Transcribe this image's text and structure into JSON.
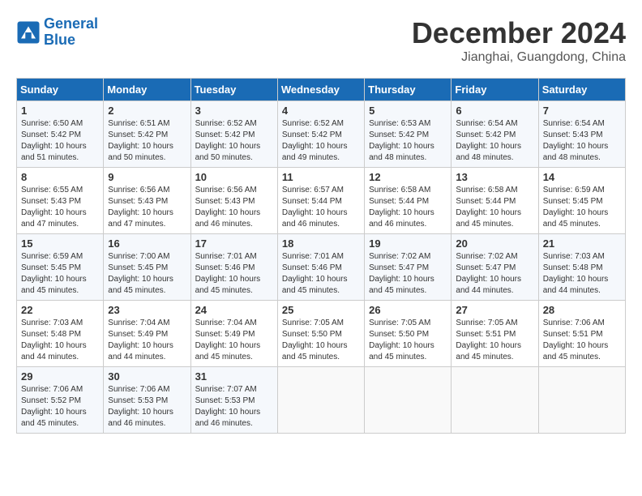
{
  "logo": {
    "line1": "General",
    "line2": "Blue"
  },
  "title": "December 2024",
  "location": "Jianghai, Guangdong, China",
  "days_of_week": [
    "Sunday",
    "Monday",
    "Tuesday",
    "Wednesday",
    "Thursday",
    "Friday",
    "Saturday"
  ],
  "weeks": [
    [
      {
        "day": "1",
        "sunrise": "6:50 AM",
        "sunset": "5:42 PM",
        "daylight": "10 hours and 51 minutes."
      },
      {
        "day": "2",
        "sunrise": "6:51 AM",
        "sunset": "5:42 PM",
        "daylight": "10 hours and 50 minutes."
      },
      {
        "day": "3",
        "sunrise": "6:52 AM",
        "sunset": "5:42 PM",
        "daylight": "10 hours and 50 minutes."
      },
      {
        "day": "4",
        "sunrise": "6:52 AM",
        "sunset": "5:42 PM",
        "daylight": "10 hours and 49 minutes."
      },
      {
        "day": "5",
        "sunrise": "6:53 AM",
        "sunset": "5:42 PM",
        "daylight": "10 hours and 48 minutes."
      },
      {
        "day": "6",
        "sunrise": "6:54 AM",
        "sunset": "5:42 PM",
        "daylight": "10 hours and 48 minutes."
      },
      {
        "day": "7",
        "sunrise": "6:54 AM",
        "sunset": "5:43 PM",
        "daylight": "10 hours and 48 minutes."
      }
    ],
    [
      {
        "day": "8",
        "sunrise": "6:55 AM",
        "sunset": "5:43 PM",
        "daylight": "10 hours and 47 minutes."
      },
      {
        "day": "9",
        "sunrise": "6:56 AM",
        "sunset": "5:43 PM",
        "daylight": "10 hours and 47 minutes."
      },
      {
        "day": "10",
        "sunrise": "6:56 AM",
        "sunset": "5:43 PM",
        "daylight": "10 hours and 46 minutes."
      },
      {
        "day": "11",
        "sunrise": "6:57 AM",
        "sunset": "5:44 PM",
        "daylight": "10 hours and 46 minutes."
      },
      {
        "day": "12",
        "sunrise": "6:58 AM",
        "sunset": "5:44 PM",
        "daylight": "10 hours and 46 minutes."
      },
      {
        "day": "13",
        "sunrise": "6:58 AM",
        "sunset": "5:44 PM",
        "daylight": "10 hours and 45 minutes."
      },
      {
        "day": "14",
        "sunrise": "6:59 AM",
        "sunset": "5:45 PM",
        "daylight": "10 hours and 45 minutes."
      }
    ],
    [
      {
        "day": "15",
        "sunrise": "6:59 AM",
        "sunset": "5:45 PM",
        "daylight": "10 hours and 45 minutes."
      },
      {
        "day": "16",
        "sunrise": "7:00 AM",
        "sunset": "5:45 PM",
        "daylight": "10 hours and 45 minutes."
      },
      {
        "day": "17",
        "sunrise": "7:01 AM",
        "sunset": "5:46 PM",
        "daylight": "10 hours and 45 minutes."
      },
      {
        "day": "18",
        "sunrise": "7:01 AM",
        "sunset": "5:46 PM",
        "daylight": "10 hours and 45 minutes."
      },
      {
        "day": "19",
        "sunrise": "7:02 AM",
        "sunset": "5:47 PM",
        "daylight": "10 hours and 45 minutes."
      },
      {
        "day": "20",
        "sunrise": "7:02 AM",
        "sunset": "5:47 PM",
        "daylight": "10 hours and 44 minutes."
      },
      {
        "day": "21",
        "sunrise": "7:03 AM",
        "sunset": "5:48 PM",
        "daylight": "10 hours and 44 minutes."
      }
    ],
    [
      {
        "day": "22",
        "sunrise": "7:03 AM",
        "sunset": "5:48 PM",
        "daylight": "10 hours and 44 minutes."
      },
      {
        "day": "23",
        "sunrise": "7:04 AM",
        "sunset": "5:49 PM",
        "daylight": "10 hours and 44 minutes."
      },
      {
        "day": "24",
        "sunrise": "7:04 AM",
        "sunset": "5:49 PM",
        "daylight": "10 hours and 45 minutes."
      },
      {
        "day": "25",
        "sunrise": "7:05 AM",
        "sunset": "5:50 PM",
        "daylight": "10 hours and 45 minutes."
      },
      {
        "day": "26",
        "sunrise": "7:05 AM",
        "sunset": "5:50 PM",
        "daylight": "10 hours and 45 minutes."
      },
      {
        "day": "27",
        "sunrise": "7:05 AM",
        "sunset": "5:51 PM",
        "daylight": "10 hours and 45 minutes."
      },
      {
        "day": "28",
        "sunrise": "7:06 AM",
        "sunset": "5:51 PM",
        "daylight": "10 hours and 45 minutes."
      }
    ],
    [
      {
        "day": "29",
        "sunrise": "7:06 AM",
        "sunset": "5:52 PM",
        "daylight": "10 hours and 45 minutes."
      },
      {
        "day": "30",
        "sunrise": "7:06 AM",
        "sunset": "5:53 PM",
        "daylight": "10 hours and 46 minutes."
      },
      {
        "day": "31",
        "sunrise": "7:07 AM",
        "sunset": "5:53 PM",
        "daylight": "10 hours and 46 minutes."
      },
      null,
      null,
      null,
      null
    ]
  ]
}
